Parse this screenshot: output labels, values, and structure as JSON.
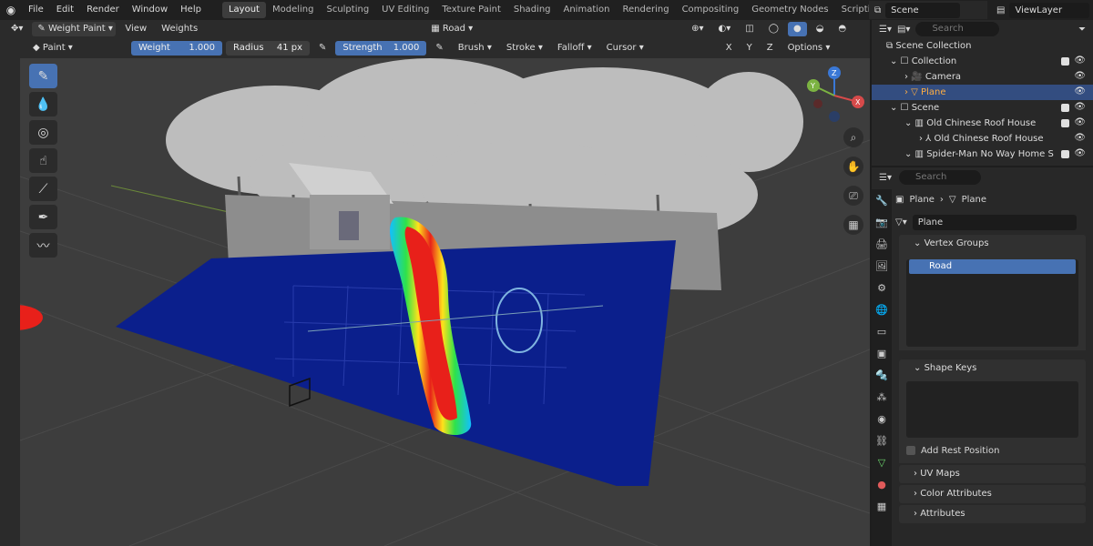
{
  "menubar": {
    "items": [
      "File",
      "Edit",
      "Render",
      "Window",
      "Help"
    ],
    "workspaces": [
      "Layout",
      "Modeling",
      "Sculpting",
      "UV Editing",
      "Texture Paint",
      "Shading",
      "Animation",
      "Rendering",
      "Compositing",
      "Geometry Nodes",
      "Scripting"
    ],
    "active_workspace": "Layout",
    "scene": "Scene",
    "view_layer": "ViewLayer"
  },
  "header": {
    "mode": "Weight Paint",
    "menus": [
      "View",
      "Weights"
    ],
    "vertex_group": "Road"
  },
  "tool_settings": {
    "brush": "Paint",
    "weight_label": "Weight",
    "weight_value": "1.000",
    "radius_label": "Radius",
    "radius_value": "41 px",
    "strength_label": "Strength",
    "strength_value": "1.000",
    "menus": [
      "Brush",
      "Stroke",
      "Falloff",
      "Cursor"
    ],
    "axes": [
      "X",
      "Y",
      "Z"
    ],
    "options": "Options"
  },
  "outliner": {
    "search_placeholder": "Search",
    "rows": [
      {
        "label": "Scene Collection",
        "indent": 0
      },
      {
        "label": "Collection",
        "indent": 1
      },
      {
        "label": "Camera",
        "indent": 2
      },
      {
        "label": "Plane",
        "indent": 2
      },
      {
        "label": "Scene",
        "indent": 1
      },
      {
        "label": "Old Chinese Roof House",
        "indent": 2
      },
      {
        "label": "Old Chinese Roof House",
        "indent": 3
      },
      {
        "label": "Spider-Man No Way Home S",
        "indent": 2
      }
    ],
    "selected_row": "Plane"
  },
  "properties": {
    "search_placeholder": "Search",
    "breadcrumb": [
      "Plane",
      "Plane"
    ],
    "mesh_name": "Plane",
    "vertex_groups_title": "Vertex Groups",
    "vertex_groups": [
      "Road"
    ],
    "shape_keys_title": "Shape Keys",
    "add_rest_position": "Add Rest Position",
    "collapsed_panels": [
      "UV Maps",
      "Color Attributes",
      "Attributes"
    ]
  },
  "colors": {
    "accent": "#4772b3",
    "selection": "#334d80",
    "weight_high": "#e8201a",
    "weight_low": "#0b1f8c"
  }
}
